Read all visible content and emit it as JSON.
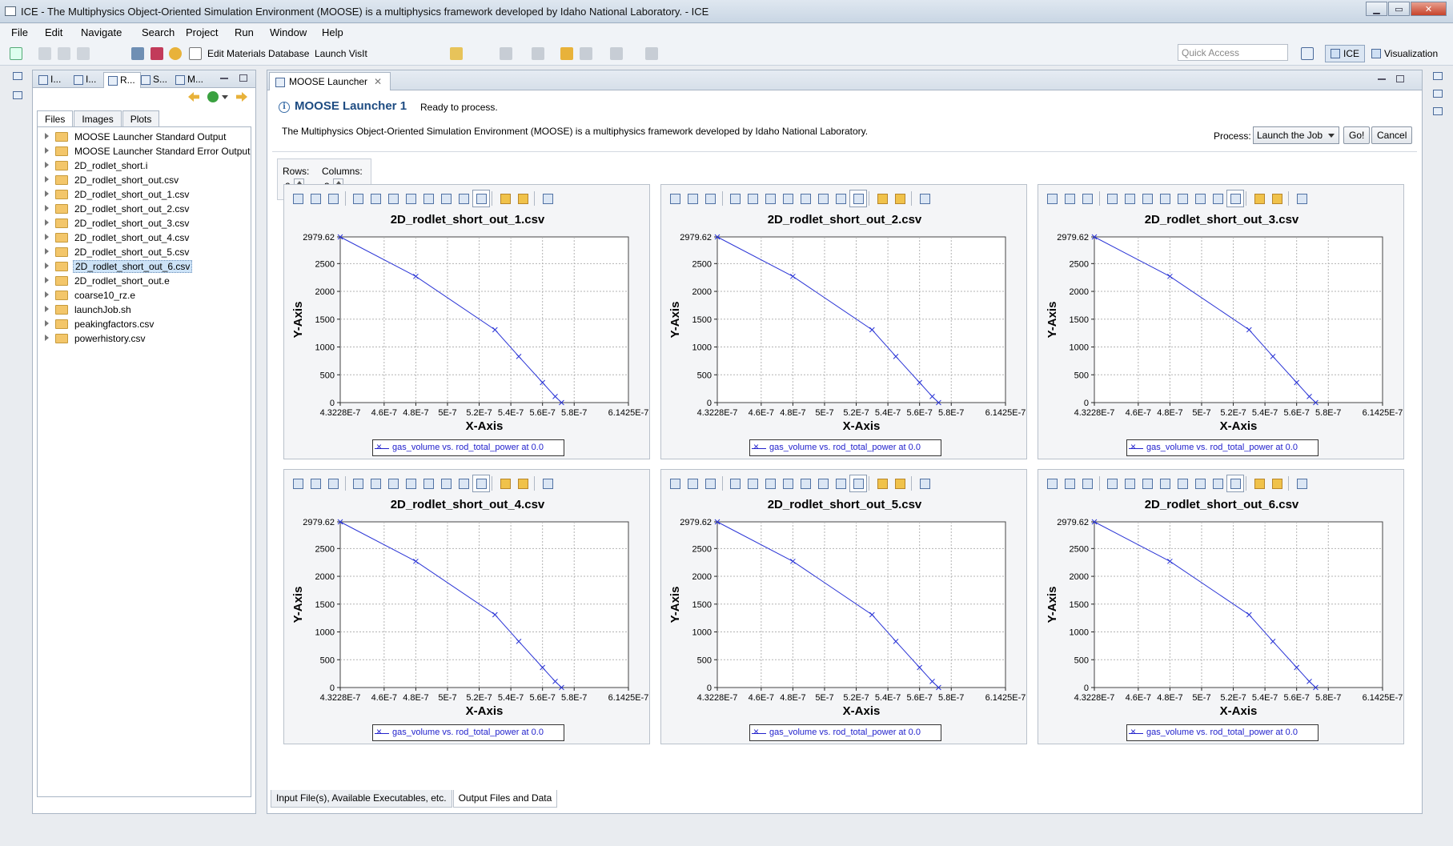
{
  "window": {
    "title": "ICE - The Multiphysics Object-Oriented Simulation Environment (MOOSE) is a multiphysics framework developed by Idaho National Laboratory. - ICE"
  },
  "menu": [
    "File",
    "Edit",
    "Navigate",
    "Search",
    "Project",
    "Run",
    "Window",
    "Help"
  ],
  "toolbar": {
    "edit_materials": "Edit Materials Database",
    "launch_visit": "Launch VisIt",
    "quick_access_placeholder": "Quick Access"
  },
  "perspectives": {
    "ice": "ICE",
    "visualization": "Visualization"
  },
  "left_panel": {
    "tabs": [
      "I...",
      "I...",
      "R...",
      "S...",
      "M..."
    ],
    "subtabs": [
      "Files",
      "Images",
      "Plots"
    ],
    "files": [
      "MOOSE Launcher Standard Output",
      "MOOSE Launcher Standard Error Output",
      "2D_rodlet_short.i",
      "2D_rodlet_short_out.csv",
      "2D_rodlet_short_out_1.csv",
      "2D_rodlet_short_out_2.csv",
      "2D_rodlet_short_out_3.csv",
      "2D_rodlet_short_out_4.csv",
      "2D_rodlet_short_out_5.csv",
      "2D_rodlet_short_out_6.csv",
      "2D_rodlet_short_out.e",
      "coarse10_rz.e",
      "launchJob.sh",
      "peakingfactors.csv",
      "powerhistory.csv"
    ],
    "selected_file": "2D_rodlet_short_out_6.csv"
  },
  "editor": {
    "tab_label": "MOOSE Launcher",
    "form_title": "MOOSE Launcher 1",
    "status": "Ready to process.",
    "description": "The Multiphysics Object-Oriented Simulation Environment (MOOSE) is a multiphysics framework developed by Idaho National Laboratory.",
    "process_label": "Process:",
    "process_value": "Launch the Job",
    "go_label": "Go!",
    "cancel_label": "Cancel",
    "rows_label": "Rows:",
    "rows_value": "2",
    "columns_label": "Columns:",
    "columns_value": "3",
    "bottom_tabs": [
      "Input File(s), Available Executables, etc.",
      "Output Files and Data"
    ]
  },
  "chart_data": [
    {
      "type": "line",
      "title": "2D_rodlet_short_out_1.csv",
      "xlabel": "X-Axis",
      "ylabel": "Y-Axis",
      "x_ticks": [
        "4.3228E-7",
        "4.6E-7",
        "4.8E-7",
        "5E-7",
        "5.2E-7",
        "5.4E-7",
        "5.6E-7",
        "5.8E-7",
        "6.1425E-7"
      ],
      "y_ticks": [
        "0",
        "500",
        "1000",
        "1500",
        "2000",
        "2500",
        "2979.62"
      ],
      "xlim": [
        4.3228e-07,
        6.1425e-07
      ],
      "ylim": [
        0,
        2979.62
      ],
      "grid": true,
      "series": [
        {
          "name": "gas_volume vs. rod_total_power at 0.0",
          "x": [
            4.3228e-07,
            4.8e-07,
            5.3e-07,
            5.45e-07,
            5.6e-07,
            5.68e-07,
            5.72e-07
          ],
          "y": [
            2979.62,
            2270,
            1310,
            830,
            360,
            110,
            0
          ]
        }
      ]
    },
    {
      "type": "line",
      "title": "2D_rodlet_short_out_2.csv",
      "xlabel": "X-Axis",
      "ylabel": "Y-Axis",
      "x_ticks": [
        "4.3228E-7",
        "4.6E-7",
        "4.8E-7",
        "5E-7",
        "5.2E-7",
        "5.4E-7",
        "5.6E-7",
        "5.8E-7",
        "6.1425E-7"
      ],
      "y_ticks": [
        "0",
        "500",
        "1000",
        "1500",
        "2000",
        "2500",
        "2979.62"
      ],
      "xlim": [
        4.3228e-07,
        6.1425e-07
      ],
      "ylim": [
        0,
        2979.62
      ],
      "grid": true,
      "series": [
        {
          "name": "gas_volume vs. rod_total_power at 0.0",
          "x": [
            4.3228e-07,
            4.8e-07,
            5.3e-07,
            5.45e-07,
            5.6e-07,
            5.68e-07,
            5.72e-07
          ],
          "y": [
            2979.62,
            2270,
            1310,
            830,
            360,
            110,
            0
          ]
        }
      ]
    },
    {
      "type": "line",
      "title": "2D_rodlet_short_out_3.csv",
      "xlabel": "X-Axis",
      "ylabel": "Y-Axis",
      "x_ticks": [
        "4.3228E-7",
        "4.6E-7",
        "4.8E-7",
        "5E-7",
        "5.2E-7",
        "5.4E-7",
        "5.6E-7",
        "5.8E-7",
        "6.1425E-7"
      ],
      "y_ticks": [
        "0",
        "500",
        "1000",
        "1500",
        "2000",
        "2500",
        "2979.62"
      ],
      "xlim": [
        4.3228e-07,
        6.1425e-07
      ],
      "ylim": [
        0,
        2979.62
      ],
      "grid": true,
      "series": [
        {
          "name": "gas_volume vs. rod_total_power at 0.0",
          "x": [
            4.3228e-07,
            4.8e-07,
            5.3e-07,
            5.45e-07,
            5.6e-07,
            5.68e-07,
            5.72e-07
          ],
          "y": [
            2979.62,
            2270,
            1310,
            830,
            360,
            110,
            0
          ]
        }
      ]
    },
    {
      "type": "line",
      "title": "2D_rodlet_short_out_4.csv",
      "xlabel": "X-Axis",
      "ylabel": "Y-Axis",
      "x_ticks": [
        "4.3228E-7",
        "4.6E-7",
        "4.8E-7",
        "5E-7",
        "5.2E-7",
        "5.4E-7",
        "5.6E-7",
        "5.8E-7",
        "6.1425E-7"
      ],
      "y_ticks": [
        "0",
        "500",
        "1000",
        "1500",
        "2000",
        "2500",
        "2979.62"
      ],
      "xlim": [
        4.3228e-07,
        6.1425e-07
      ],
      "ylim": [
        0,
        2979.62
      ],
      "grid": true,
      "series": [
        {
          "name": "gas_volume vs. rod_total_power at 0.0",
          "x": [
            4.3228e-07,
            4.8e-07,
            5.3e-07,
            5.45e-07,
            5.6e-07,
            5.68e-07,
            5.72e-07
          ],
          "y": [
            2979.62,
            2270,
            1310,
            830,
            360,
            110,
            0
          ]
        }
      ]
    },
    {
      "type": "line",
      "title": "2D_rodlet_short_out_5.csv",
      "xlabel": "X-Axis",
      "ylabel": "Y-Axis",
      "x_ticks": [
        "4.3228E-7",
        "4.6E-7",
        "4.8E-7",
        "5E-7",
        "5.2E-7",
        "5.4E-7",
        "5.6E-7",
        "5.8E-7",
        "6.1425E-7"
      ],
      "y_ticks": [
        "0",
        "500",
        "1000",
        "1500",
        "2000",
        "2500",
        "2979.62"
      ],
      "xlim": [
        4.3228e-07,
        6.1425e-07
      ],
      "ylim": [
        0,
        2979.62
      ],
      "grid": true,
      "series": [
        {
          "name": "gas_volume vs. rod_total_power at 0.0",
          "x": [
            4.3228e-07,
            4.8e-07,
            5.3e-07,
            5.45e-07,
            5.6e-07,
            5.68e-07,
            5.72e-07
          ],
          "y": [
            2979.62,
            2270,
            1310,
            830,
            360,
            110,
            0
          ]
        }
      ]
    },
    {
      "type": "line",
      "title": "2D_rodlet_short_out_6.csv",
      "xlabel": "X-Axis",
      "ylabel": "Y-Axis",
      "x_ticks": [
        "4.3228E-7",
        "4.6E-7",
        "4.8E-7",
        "5E-7",
        "5.2E-7",
        "5.4E-7",
        "5.6E-7",
        "5.8E-7",
        "6.1425E-7"
      ],
      "y_ticks": [
        "0",
        "500",
        "1000",
        "1500",
        "2000",
        "2500",
        "2979.62"
      ],
      "xlim": [
        4.3228e-07,
        6.1425e-07
      ],
      "ylim": [
        0,
        2979.62
      ],
      "grid": true,
      "series": [
        {
          "name": "gas_volume vs. rod_total_power at 0.0",
          "x": [
            4.3228e-07,
            4.8e-07,
            5.3e-07,
            5.45e-07,
            5.6e-07,
            5.68e-07,
            5.72e-07
          ],
          "y": [
            2979.62,
            2270,
            1310,
            830,
            360,
            110,
            0
          ]
        }
      ]
    }
  ],
  "colors": {
    "series": "#2b35d6",
    "title_blue": "#1e4c82",
    "grid": "#b3b3b3"
  }
}
